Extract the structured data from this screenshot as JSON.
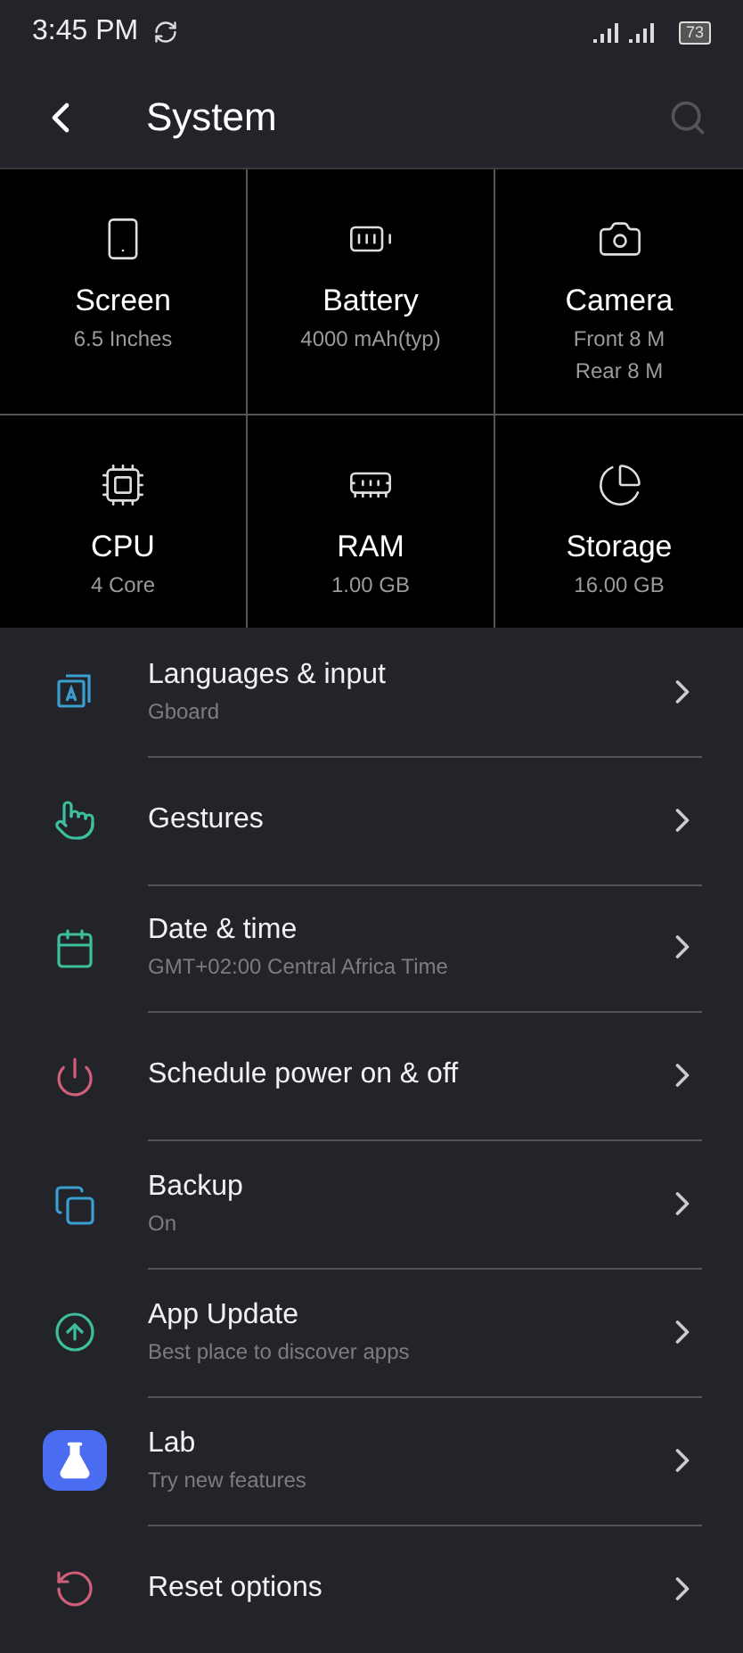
{
  "status_bar": {
    "time": "3:45 PM",
    "battery": "73"
  },
  "header": {
    "title": "System"
  },
  "specs": [
    {
      "kind": "screen",
      "label": "Screen",
      "lines": [
        "6.5 Inches"
      ]
    },
    {
      "kind": "battery",
      "label": "Battery",
      "lines": [
        "4000 mAh(typ)"
      ]
    },
    {
      "kind": "camera",
      "label": "Camera",
      "lines": [
        "Front 8 M",
        "Rear 8 M"
      ]
    },
    {
      "kind": "cpu",
      "label": "CPU",
      "lines": [
        "4 Core"
      ]
    },
    {
      "kind": "ram",
      "label": "RAM",
      "lines": [
        "1.00 GB"
      ]
    },
    {
      "kind": "storage",
      "label": "Storage",
      "lines": [
        "16.00 GB"
      ]
    }
  ],
  "settings": [
    {
      "kind": "language",
      "color": "#3a9fd0",
      "title": "Languages & input",
      "subtitle": "Gboard"
    },
    {
      "kind": "gesture",
      "color": "#3dbf9c",
      "title": "Gestures"
    },
    {
      "kind": "calendar",
      "color": "#3dbf9c",
      "title": "Date & time",
      "subtitle": "GMT+02:00 Central Africa Time"
    },
    {
      "kind": "power",
      "color": "#d0607a",
      "title": "Schedule power on & off"
    },
    {
      "kind": "backup",
      "color": "#3a9fd0",
      "title": "Backup",
      "subtitle": "On"
    },
    {
      "kind": "update",
      "color": "#3dbf9c",
      "title": "App Update",
      "subtitle": "Best place to discover apps"
    },
    {
      "kind": "lab",
      "color": "#4a6cf0",
      "title": "Lab",
      "subtitle": "Try new features"
    },
    {
      "kind": "reset",
      "color": "#d0607a",
      "title": "Reset options"
    }
  ]
}
